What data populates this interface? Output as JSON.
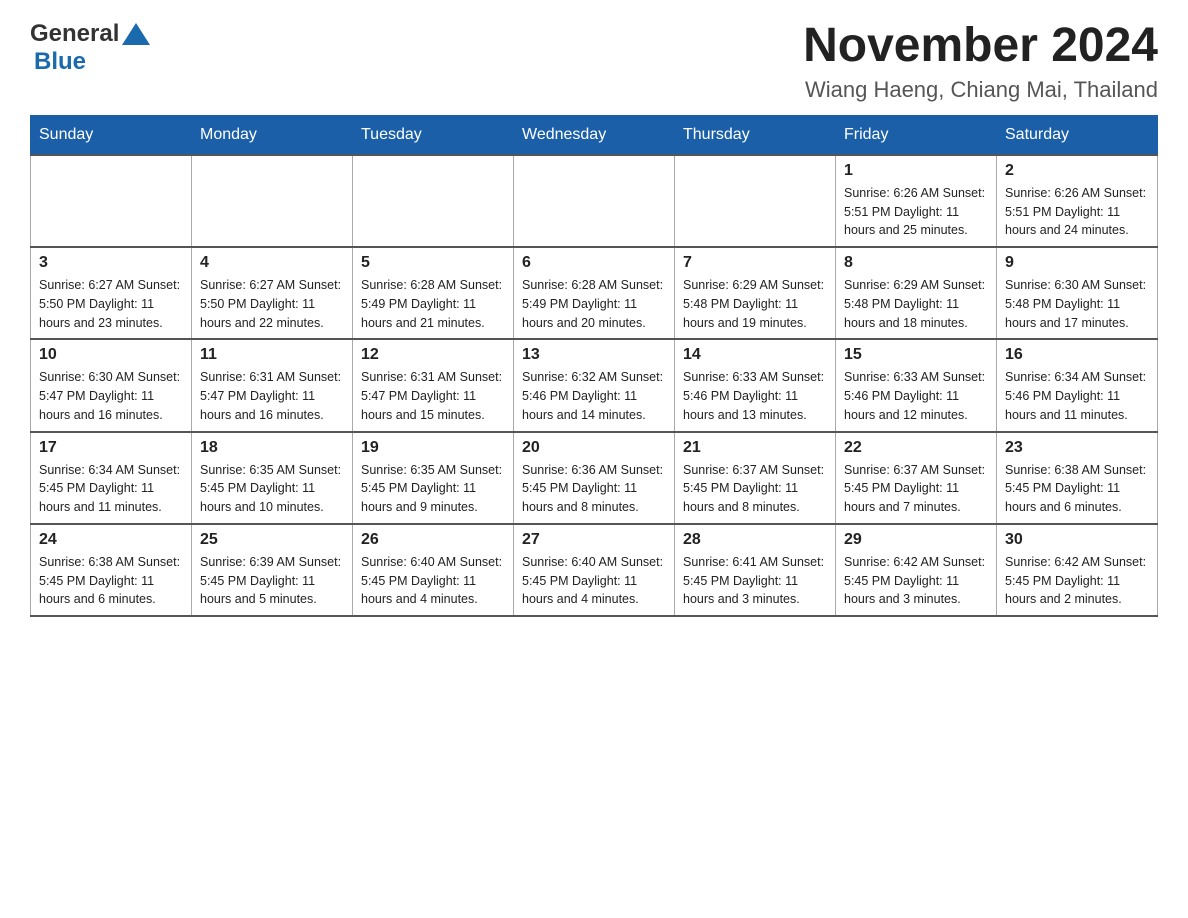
{
  "header": {
    "logo_general": "General",
    "logo_blue": "Blue",
    "month_title": "November 2024",
    "subtitle": "Wiang Haeng, Chiang Mai, Thailand"
  },
  "days_of_week": [
    "Sunday",
    "Monday",
    "Tuesday",
    "Wednesday",
    "Thursday",
    "Friday",
    "Saturday"
  ],
  "weeks": [
    [
      {
        "day": "",
        "info": ""
      },
      {
        "day": "",
        "info": ""
      },
      {
        "day": "",
        "info": ""
      },
      {
        "day": "",
        "info": ""
      },
      {
        "day": "",
        "info": ""
      },
      {
        "day": "1",
        "info": "Sunrise: 6:26 AM\nSunset: 5:51 PM\nDaylight: 11 hours and 25 minutes."
      },
      {
        "day": "2",
        "info": "Sunrise: 6:26 AM\nSunset: 5:51 PM\nDaylight: 11 hours and 24 minutes."
      }
    ],
    [
      {
        "day": "3",
        "info": "Sunrise: 6:27 AM\nSunset: 5:50 PM\nDaylight: 11 hours and 23 minutes."
      },
      {
        "day": "4",
        "info": "Sunrise: 6:27 AM\nSunset: 5:50 PM\nDaylight: 11 hours and 22 minutes."
      },
      {
        "day": "5",
        "info": "Sunrise: 6:28 AM\nSunset: 5:49 PM\nDaylight: 11 hours and 21 minutes."
      },
      {
        "day": "6",
        "info": "Sunrise: 6:28 AM\nSunset: 5:49 PM\nDaylight: 11 hours and 20 minutes."
      },
      {
        "day": "7",
        "info": "Sunrise: 6:29 AM\nSunset: 5:48 PM\nDaylight: 11 hours and 19 minutes."
      },
      {
        "day": "8",
        "info": "Sunrise: 6:29 AM\nSunset: 5:48 PM\nDaylight: 11 hours and 18 minutes."
      },
      {
        "day": "9",
        "info": "Sunrise: 6:30 AM\nSunset: 5:48 PM\nDaylight: 11 hours and 17 minutes."
      }
    ],
    [
      {
        "day": "10",
        "info": "Sunrise: 6:30 AM\nSunset: 5:47 PM\nDaylight: 11 hours and 16 minutes."
      },
      {
        "day": "11",
        "info": "Sunrise: 6:31 AM\nSunset: 5:47 PM\nDaylight: 11 hours and 16 minutes."
      },
      {
        "day": "12",
        "info": "Sunrise: 6:31 AM\nSunset: 5:47 PM\nDaylight: 11 hours and 15 minutes."
      },
      {
        "day": "13",
        "info": "Sunrise: 6:32 AM\nSunset: 5:46 PM\nDaylight: 11 hours and 14 minutes."
      },
      {
        "day": "14",
        "info": "Sunrise: 6:33 AM\nSunset: 5:46 PM\nDaylight: 11 hours and 13 minutes."
      },
      {
        "day": "15",
        "info": "Sunrise: 6:33 AM\nSunset: 5:46 PM\nDaylight: 11 hours and 12 minutes."
      },
      {
        "day": "16",
        "info": "Sunrise: 6:34 AM\nSunset: 5:46 PM\nDaylight: 11 hours and 11 minutes."
      }
    ],
    [
      {
        "day": "17",
        "info": "Sunrise: 6:34 AM\nSunset: 5:45 PM\nDaylight: 11 hours and 11 minutes."
      },
      {
        "day": "18",
        "info": "Sunrise: 6:35 AM\nSunset: 5:45 PM\nDaylight: 11 hours and 10 minutes."
      },
      {
        "day": "19",
        "info": "Sunrise: 6:35 AM\nSunset: 5:45 PM\nDaylight: 11 hours and 9 minutes."
      },
      {
        "day": "20",
        "info": "Sunrise: 6:36 AM\nSunset: 5:45 PM\nDaylight: 11 hours and 8 minutes."
      },
      {
        "day": "21",
        "info": "Sunrise: 6:37 AM\nSunset: 5:45 PM\nDaylight: 11 hours and 8 minutes."
      },
      {
        "day": "22",
        "info": "Sunrise: 6:37 AM\nSunset: 5:45 PM\nDaylight: 11 hours and 7 minutes."
      },
      {
        "day": "23",
        "info": "Sunrise: 6:38 AM\nSunset: 5:45 PM\nDaylight: 11 hours and 6 minutes."
      }
    ],
    [
      {
        "day": "24",
        "info": "Sunrise: 6:38 AM\nSunset: 5:45 PM\nDaylight: 11 hours and 6 minutes."
      },
      {
        "day": "25",
        "info": "Sunrise: 6:39 AM\nSunset: 5:45 PM\nDaylight: 11 hours and 5 minutes."
      },
      {
        "day": "26",
        "info": "Sunrise: 6:40 AM\nSunset: 5:45 PM\nDaylight: 11 hours and 4 minutes."
      },
      {
        "day": "27",
        "info": "Sunrise: 6:40 AM\nSunset: 5:45 PM\nDaylight: 11 hours and 4 minutes."
      },
      {
        "day": "28",
        "info": "Sunrise: 6:41 AM\nSunset: 5:45 PM\nDaylight: 11 hours and 3 minutes."
      },
      {
        "day": "29",
        "info": "Sunrise: 6:42 AM\nSunset: 5:45 PM\nDaylight: 11 hours and 3 minutes."
      },
      {
        "day": "30",
        "info": "Sunrise: 6:42 AM\nSunset: 5:45 PM\nDaylight: 11 hours and 2 minutes."
      }
    ]
  ]
}
